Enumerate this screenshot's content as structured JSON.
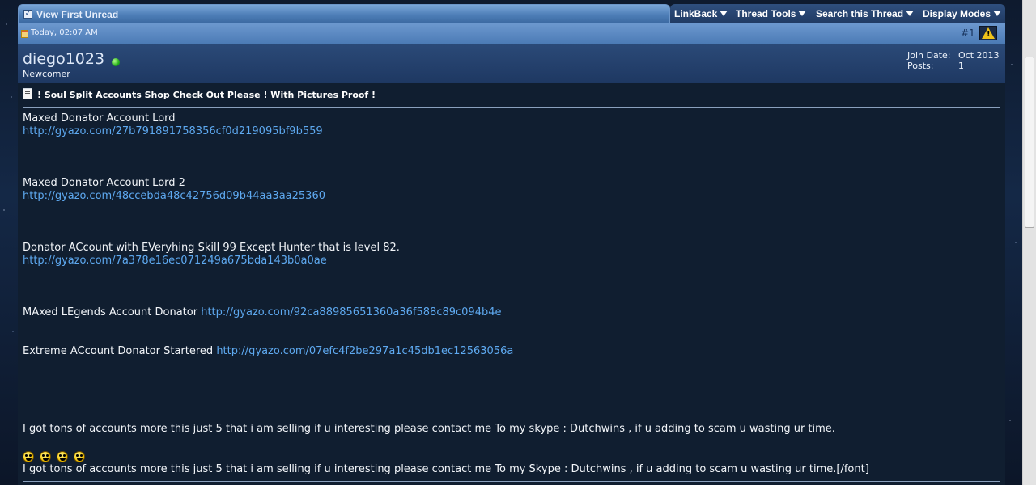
{
  "toolbar": {
    "view_first_unread": "View First Unread",
    "menu": [
      "LinkBack",
      "Thread Tools",
      "Search this Thread",
      "Display Modes"
    ]
  },
  "post": {
    "date": "Today, 02:07 AM",
    "number": "#1",
    "username": "diego1023",
    "user_title": "Newcomer",
    "join_date_label": "Join Date:",
    "join_date": "Oct 2013",
    "posts_label": "Posts:",
    "posts": "1",
    "title": "! Soul Split Accounts Shop Check Out Please ! With Pictures Proof !",
    "lines": {
      "l1": "Maxed Donator Account Lord",
      "l1_link": "http://gyazo.com/27b791891758356cf0d219095bf9b559",
      "l2": "Maxed Donator Account Lord 2",
      "l2_link": "http://gyazo.com/48ccebda48c42756d09b44aa3aa25360",
      "l3": "Donator ACcount with EVeryhing Skill 99 Except Hunter that is level 82.",
      "l3_link": "http://gyazo.com/7a378e16ec071249a675bda143b0a0ae",
      "l4": "MAxed LEgends Account Donator ",
      "l4_link": "http://gyazo.com/92ca88985651360a36f588c89c094b4e",
      "l5": "Extreme ACcount Donator Startered ",
      "l5_link": "http://gyazo.com/07efc4f2be297a1c45db1ec12563056a",
      "l6": "I got tons of accounts more this just 5 that i am selling if u interesting please contact me To my skype : Dutchwins , if u adding to scam u wasting ur time.",
      "l7": "I got tons of accounts more this just 5 that i am selling if u interesting please contact me To my Skype : Dutchwins , if u adding to scam u wasting ur time.[/font]"
    },
    "smileys": [
      "smiley-icon",
      "smiley-icon",
      "smiley-icon",
      "smiley-icon"
    ]
  },
  "colors": {
    "link": "#5ea9f0",
    "online": "#26b01a"
  }
}
